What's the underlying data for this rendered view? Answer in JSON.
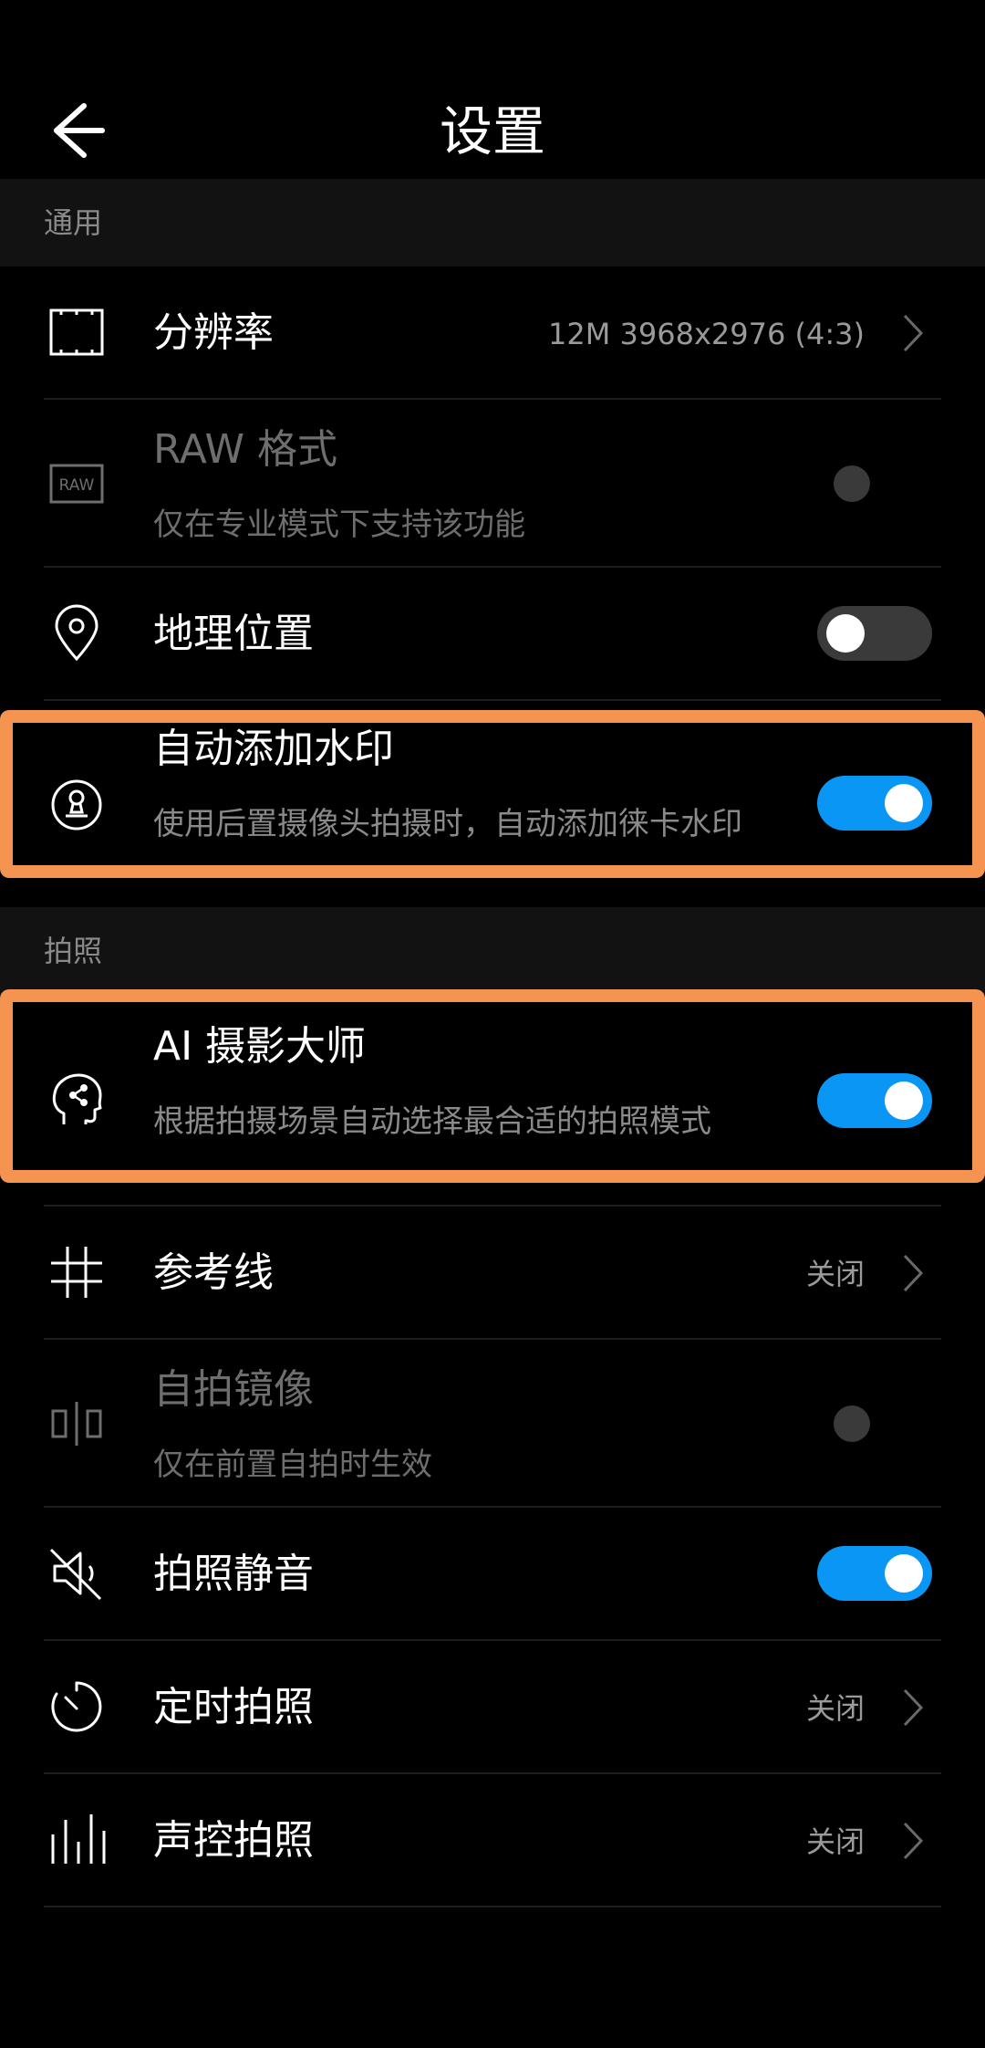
{
  "header": {
    "title": "设置",
    "back_icon": "back-arrow-icon"
  },
  "sections": {
    "general": "通用",
    "photo": "拍照"
  },
  "rows": {
    "resolution": {
      "label": "分辨率",
      "value": "12M 3968x2976 (4:3)",
      "icon": "resolution-frame-icon"
    },
    "raw": {
      "label": "RAW 格式",
      "sub": "仅在专业模式下支持该功能",
      "icon": "raw-icon",
      "raw_text": "RAW"
    },
    "location": {
      "label": "地理位置",
      "icon": "location-pin-icon",
      "toggle": "off"
    },
    "watermark": {
      "label": "自动添加水印",
      "sub": "使用后置摄像头拍摄时，自动添加徕卡水印",
      "icon": "stamp-icon",
      "toggle": "on"
    },
    "ai": {
      "label": "AI 摄影大师",
      "sub": "根据拍摄场景自动选择最合适的拍照模式",
      "icon": "ai-head-icon",
      "toggle": "on"
    },
    "grid": {
      "label": "参考线",
      "value": "关闭",
      "icon": "grid-icon"
    },
    "mirror": {
      "label": "自拍镜像",
      "sub": "仅在前置自拍时生效",
      "icon": "mirror-icon"
    },
    "mute": {
      "label": "拍照静音",
      "icon": "mute-speaker-icon",
      "toggle": "on"
    },
    "timer": {
      "label": "定时拍照",
      "value": "关闭",
      "icon": "timer-icon"
    },
    "voice": {
      "label": "声控拍照",
      "value": "关闭",
      "icon": "voice-bars-icon"
    }
  },
  "colors": {
    "accent": "#0a96f5",
    "highlight": "#f59450",
    "background": "#000000",
    "section_bg": "#121212"
  }
}
